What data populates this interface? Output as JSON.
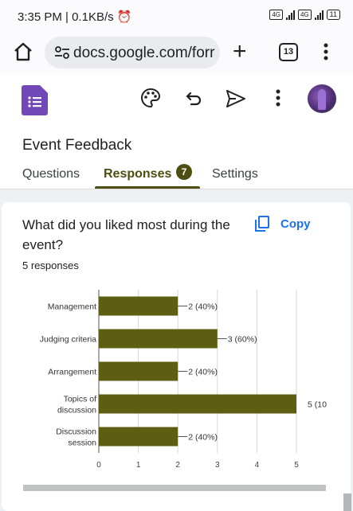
{
  "status_bar": {
    "time_net": "3:35 PM | 0.1KB/s",
    "battery": "11"
  },
  "browser": {
    "url": "docs.google.com/forr",
    "tab_count": "13"
  },
  "form": {
    "title": "Event Feedback",
    "tabs": [
      {
        "label": "Questions"
      },
      {
        "label": "Responses",
        "badge": "7"
      },
      {
        "label": "Settings"
      }
    ]
  },
  "card": {
    "question": "What did you liked most during the event?",
    "copy_label": "Copy",
    "responses": "5 responses"
  },
  "chart_data": {
    "type": "bar",
    "orientation": "horizontal",
    "categories": [
      [
        "Management"
      ],
      [
        "Judging criteria"
      ],
      [
        "Arrangement"
      ],
      [
        "Topics of",
        "discussion"
      ],
      [
        "Discussion",
        "session"
      ]
    ],
    "values": [
      2,
      3,
      2,
      5,
      2
    ],
    "data_labels": [
      "2 (40%)",
      "3 (60%)",
      "2 (40%)",
      "5 (10",
      "2 (40%)"
    ],
    "xticks": [
      "0",
      "1",
      "2",
      "3",
      "4",
      "5"
    ],
    "xlim": [
      0,
      5
    ],
    "bar_color": "#5d5e12",
    "grid": true
  },
  "colors": {
    "accent": "#4e4e12",
    "forms_purple": "#7248b9",
    "link_blue": "#1a73e8"
  }
}
